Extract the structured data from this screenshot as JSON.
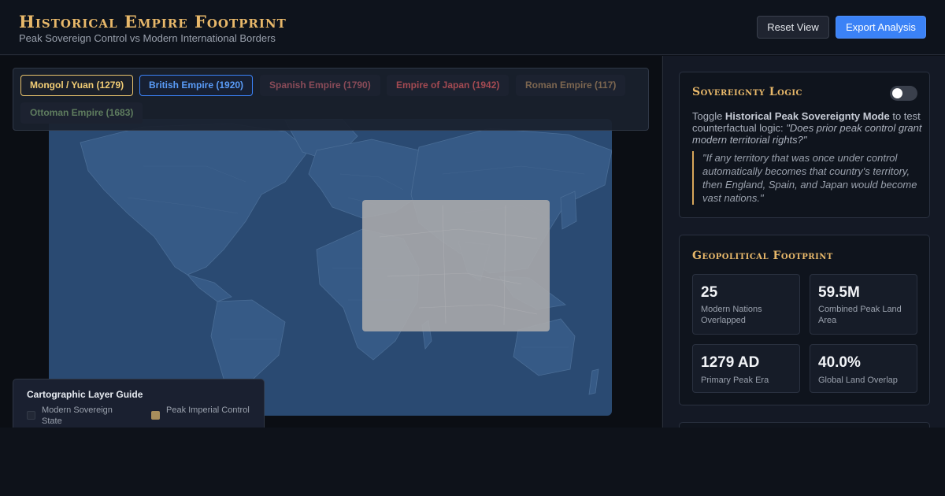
{
  "header": {
    "title": "Historical Empire Footprint",
    "subtitle": "Peak Sovereign Control vs Modern International Borders",
    "reset_label": "Reset View",
    "export_label": "Export Analysis"
  },
  "empires": [
    {
      "label": "Mongol / Yuan (1279)",
      "color": "#f2cd75",
      "selected": true
    },
    {
      "label": "British Empire (1920)",
      "color": "#5a9cf8",
      "selected": true
    },
    {
      "label": "Spanish Empire (1790)",
      "color": "#8a4b58",
      "selected": false
    },
    {
      "label": "Empire of Japan (1942)",
      "color": "#a44a52",
      "selected": false
    },
    {
      "label": "Roman Empire (117)",
      "color": "#7c6650",
      "selected": false
    },
    {
      "label": "Ottoman Empire (1683)",
      "color": "#5e7c5e",
      "selected": false
    }
  ],
  "legend": {
    "title": "Cartographic Layer Guide",
    "items": [
      {
        "label": "Modern Sovereign State",
        "color": "#222836"
      },
      {
        "label": "Peak Imperial Control",
        "color": "#a88e5c"
      }
    ]
  },
  "sovereignty": {
    "title": "Sovereignty Logic",
    "toggle_on": false,
    "intro_prefix": "Toggle ",
    "intro_bold": "Historical Peak Sovereignty Mode",
    "intro_mid": " to test counterfactual logic: ",
    "intro_question": "\"Does prior peak control grant modern territorial rights?\"",
    "quote": "\"If any territory that was once under control automatically becomes that country's territory, then England, Spain, and Japan would become vast nations.\""
  },
  "footprint": {
    "title": "Geopolitical Footprint",
    "stats": [
      {
        "value": "25",
        "label": "Modern Nations Overlapped"
      },
      {
        "value": "59.5M",
        "label": "Combined Peak Land Area"
      },
      {
        "value": "1279 AD",
        "label": "Primary Peak Era"
      },
      {
        "value": "40.0%",
        "label": "Global Land Overlap"
      }
    ]
  },
  "colors": {
    "accent_gold": "#e8b86a",
    "accent_blue": "#3b82f6",
    "ocean": "#2a4a72",
    "land": "#365a86"
  }
}
